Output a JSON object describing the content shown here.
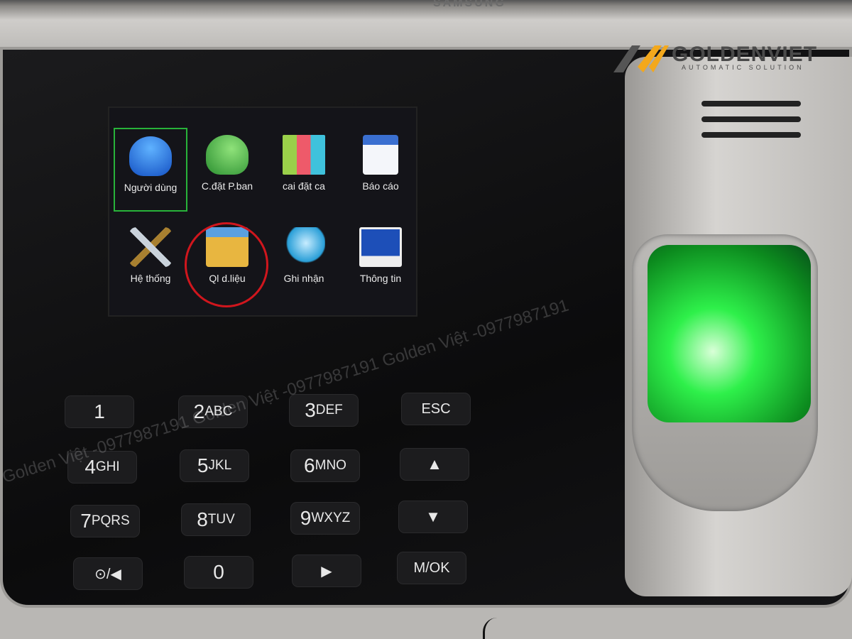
{
  "brand_top": "SAMSUNG",
  "logo": {
    "name": "GOLDENVIET",
    "tagline": "AUTOMATIC SOLUTION",
    "colors": {
      "mark": "#f3a81c",
      "text": "#4a4a4a"
    }
  },
  "watermark": "Golden Việt -0977987191 Golden Việt -0977987191 Golden Việt -0977987191",
  "menu": {
    "items": [
      {
        "label": "Người dùng",
        "icon": "user-add-icon",
        "selected": true
      },
      {
        "label": "C.đặt P.ban",
        "icon": "users-group-icon"
      },
      {
        "label": "cai đặt ca",
        "icon": "bar-chart-icon"
      },
      {
        "label": "Báo cáo",
        "icon": "calendar-icon"
      },
      {
        "label": "Hệ thống",
        "icon": "tools-icon"
      },
      {
        "label": "Ql d.liệu",
        "icon": "folder-icon",
        "highlighted": true
      },
      {
        "label": "Ghi nhận",
        "icon": "search-globe-icon"
      },
      {
        "label": "Thông tin",
        "icon": "monitor-icon"
      }
    ]
  },
  "keypad": {
    "keys": [
      {
        "main": "1",
        "sub": ""
      },
      {
        "main": "2",
        "sub": "ABC"
      },
      {
        "main": "3",
        "sub": "DEF"
      },
      {
        "main": "ESC",
        "sub": ""
      },
      {
        "main": "4",
        "sub": "GHI"
      },
      {
        "main": "5",
        "sub": "JKL"
      },
      {
        "main": "6",
        "sub": "MNO"
      },
      {
        "main": "▲",
        "sub": ""
      },
      {
        "main": "7",
        "sub": "PQRS"
      },
      {
        "main": "8",
        "sub": "TUV"
      },
      {
        "main": "9",
        "sub": "WXYZ"
      },
      {
        "main": "▼",
        "sub": ""
      },
      {
        "main": "⊙/◀",
        "sub": ""
      },
      {
        "main": "0",
        "sub": ""
      },
      {
        "main": "▶",
        "sub": ""
      },
      {
        "main": "M/OK",
        "sub": ""
      }
    ]
  }
}
